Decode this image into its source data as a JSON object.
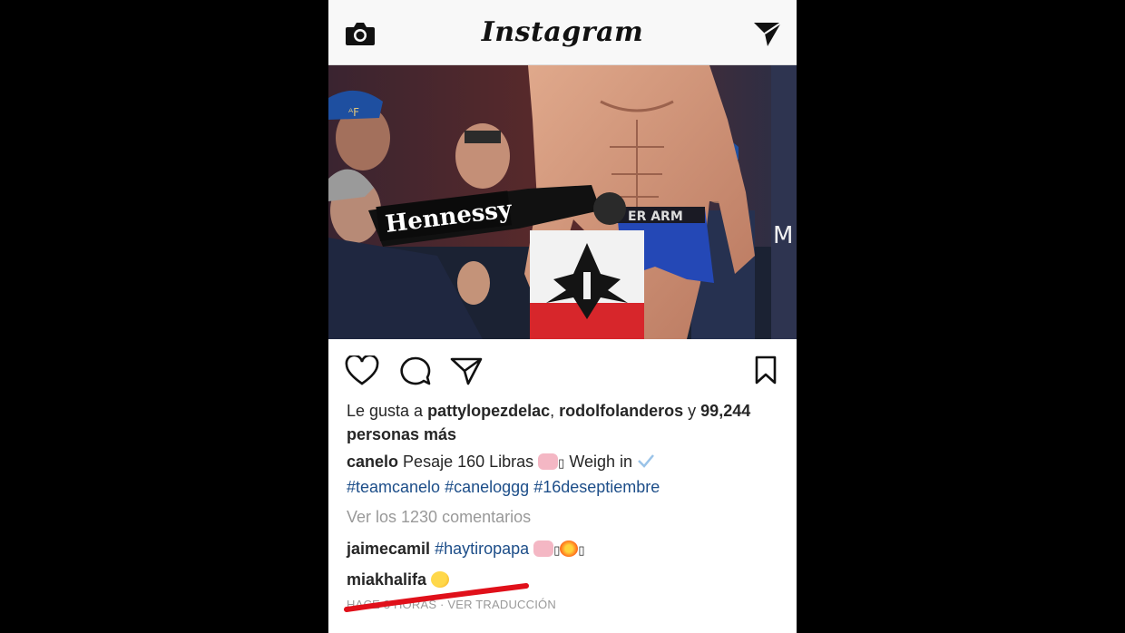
{
  "header": {
    "brand": "Instagram"
  },
  "photo": {
    "sign_text": "Hennessy",
    "waistband": "ER ARM",
    "side_text": "M"
  },
  "likes": {
    "prefix": "Le gusta a ",
    "user1": "pattylopezdelac",
    "sep": ", ",
    "user2": "rodolfolanderos",
    "and": " y ",
    "count": "99,244",
    "suffix": "personas más"
  },
  "caption": {
    "user": "canelo",
    "text": "Pesaje 160 Libras",
    "text2": "Weigh in",
    "hashtags": [
      "#teamcanelo",
      "#caneloggg",
      "#16deseptiembre"
    ]
  },
  "view_comments": "Ver los 1230 comentarios",
  "comments": [
    {
      "user": "jaimecamil",
      "text": "#haytiropapa"
    },
    {
      "user": "miakhalifa",
      "text": ""
    }
  ],
  "meta": {
    "time": "HACE 3 HORAS",
    "sep": " · ",
    "translate": "VER TRADUCCIÓN"
  },
  "colors": {
    "hashtag": "#1d4e89",
    "annotation": "#e0101a"
  }
}
